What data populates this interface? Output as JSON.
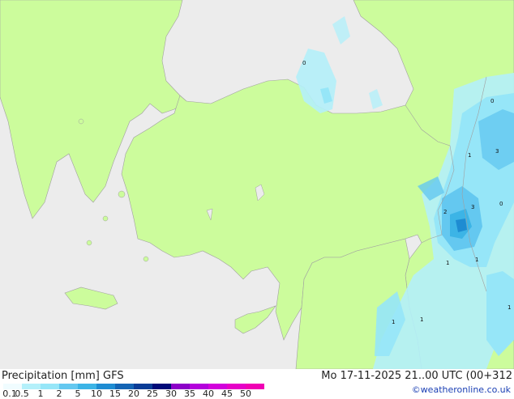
{
  "map": {
    "contour_labels": [
      "0",
      "0",
      "1",
      "3",
      "0",
      "2",
      "3",
      "1",
      "1",
      "1",
      "1",
      "1"
    ],
    "colors": {
      "sea": "#ececec",
      "land": "#ccfc9c",
      "border": "#a0a0a0"
    }
  },
  "legend": {
    "title": "Precipitation [mm]",
    "model": "GFS",
    "datetime": "Mo 17-11-2025 21..00 UTC (00+312",
    "credit": "©weatheronline.co.uk",
    "ticks": [
      "0.1",
      "0.5",
      "1",
      "2",
      "5",
      "10",
      "15",
      "20",
      "25",
      "30",
      "35",
      "40",
      "45",
      "50"
    ],
    "colors": [
      "#f0fcff",
      "#b4f0fa",
      "#96e6f8",
      "#64c8f0",
      "#3cb4e6",
      "#1e8cd2",
      "#1464b4",
      "#0a3c96",
      "#000a78",
      "#8c00c8",
      "#b400dc",
      "#d200dc",
      "#e600c8",
      "#f000b4"
    ]
  }
}
